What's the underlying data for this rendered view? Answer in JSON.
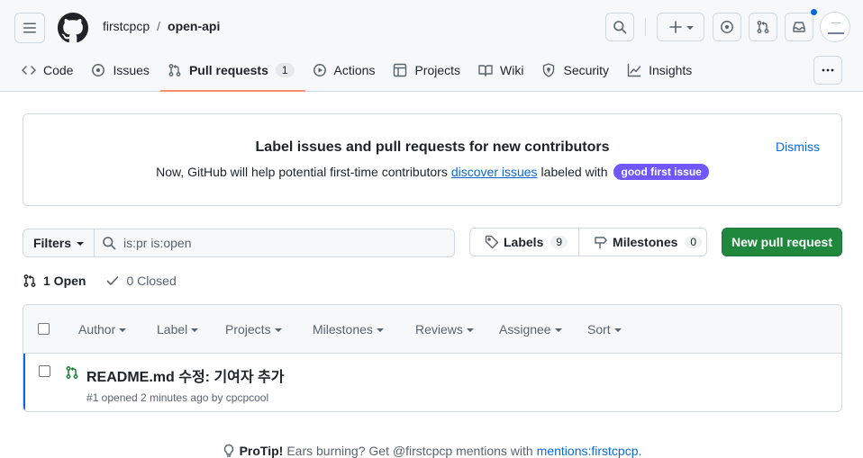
{
  "repo": {
    "owner": "firstcpcp",
    "separator": "/",
    "name": "open-api"
  },
  "header_icons": [
    "menu-icon",
    "github-logo-icon",
    "search-icon",
    "plus-icon",
    "issue-opened-icon",
    "git-pull-request-icon",
    "inbox-icon",
    "avatar"
  ],
  "tabs": [
    {
      "label": "Code",
      "icon": "code-icon"
    },
    {
      "label": "Issues",
      "icon": "issue-opened-icon"
    },
    {
      "label": "Pull requests",
      "icon": "git-pull-request-icon",
      "count": "1",
      "selected": true
    },
    {
      "label": "Actions",
      "icon": "play-icon"
    },
    {
      "label": "Projects",
      "icon": "table-icon"
    },
    {
      "label": "Wiki",
      "icon": "book-icon"
    },
    {
      "label": "Security",
      "icon": "shield-icon"
    },
    {
      "label": "Insights",
      "icon": "graph-icon"
    }
  ],
  "banner": {
    "title": "Label issues and pull requests for new contributors",
    "text_before": "Now, GitHub will help potential first-time contributors",
    "link": "discover issues",
    "text_after": "labeled with",
    "label": "good first issue",
    "dismiss": "Dismiss"
  },
  "filters": {
    "button": "Filters",
    "search_value": "is:pr is:open",
    "labels_button": "Labels",
    "labels_count": "9",
    "milestones_button": "Milestones",
    "milestones_count": "0",
    "new_pr": "New pull request"
  },
  "states": {
    "open": "1 Open",
    "closed": "0 Closed"
  },
  "list_header": [
    "Author",
    "Label",
    "Projects",
    "Milestones",
    "Reviews",
    "Assignee",
    "Sort"
  ],
  "pull_requests": [
    {
      "title": "README.md 수정: 기여자 추가",
      "meta": "#1 opened 2 minutes ago by cpcpcool"
    }
  ],
  "protip": {
    "lead": "ProTip!",
    "text": "Ears burning? Get @firstcpcp mentions with",
    "link": "mentions:firstcpcp."
  },
  "colors": {
    "accent": "#0969da",
    "tab_underline": "#fd8c73",
    "primary_button": "#1f883d",
    "good_first_issue": "#7057ff",
    "open_pr": "#1a7f37"
  }
}
